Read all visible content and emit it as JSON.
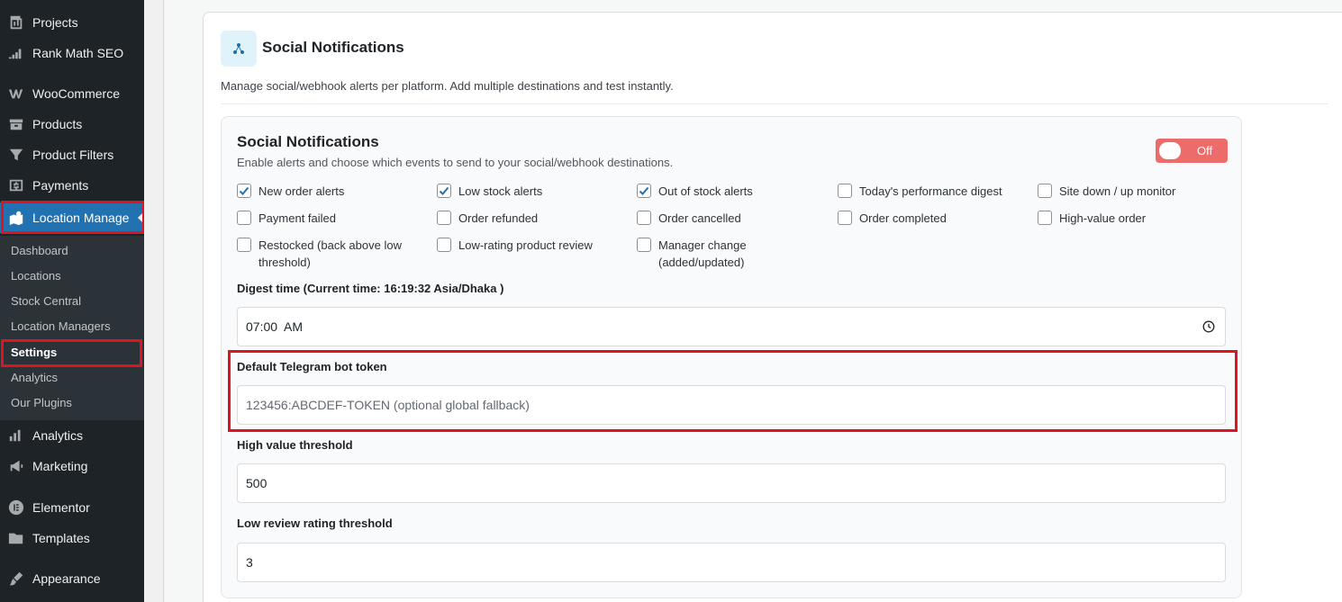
{
  "sidebar": {
    "items": [
      {
        "label": "Projects",
        "icon": "projects-icon"
      },
      {
        "label": "Rank Math SEO",
        "icon": "rank-math-icon"
      },
      {
        "label": "WooCommerce",
        "icon": "woocommerce-icon"
      },
      {
        "label": "Products",
        "icon": "products-icon"
      },
      {
        "label": "Product Filters",
        "icon": "filter-icon"
      },
      {
        "label": "Payments",
        "icon": "payments-icon"
      },
      {
        "label": "Location Manage",
        "icon": "location-icon"
      },
      {
        "label": "Analytics",
        "icon": "analytics-icon"
      },
      {
        "label": "Marketing",
        "icon": "megaphone-icon"
      },
      {
        "label": "Elementor",
        "icon": "elementor-icon"
      },
      {
        "label": "Templates",
        "icon": "folder-icon"
      },
      {
        "label": "Appearance",
        "icon": "brush-icon"
      }
    ],
    "submenu": [
      "Dashboard",
      "Locations",
      "Stock Central",
      "Location Managers",
      "Settings",
      "Analytics",
      "Our Plugins"
    ]
  },
  "panel": {
    "title": "Social Notifications",
    "description": "Manage social/webhook alerts per platform. Add multiple destinations and test instantly."
  },
  "card": {
    "title": "Social Notifications",
    "description": "Enable alerts and choose which events to send to your social/webhook destinations.",
    "toggle_label": "Off",
    "checkboxes": [
      {
        "label": "New order alerts",
        "checked": true
      },
      {
        "label": "Low stock alerts",
        "checked": true
      },
      {
        "label": "Out of stock alerts",
        "checked": true
      },
      {
        "label": "Today's performance digest",
        "checked": false
      },
      {
        "label": "Site down / up monitor",
        "checked": false
      },
      {
        "label": "Payment failed",
        "checked": false
      },
      {
        "label": "Order refunded",
        "checked": false
      },
      {
        "label": "Order cancelled",
        "checked": false
      },
      {
        "label": "Order completed",
        "checked": false
      },
      {
        "label": "High-value order",
        "checked": false
      },
      {
        "label": "Restocked (back above low threshold)",
        "checked": false
      },
      {
        "label": "Low-rating product review",
        "checked": false
      },
      {
        "label": "Manager change (added/updated)",
        "checked": false
      }
    ],
    "digest_label": "Digest time (Current time: 16:19:32 Asia/Dhaka )",
    "digest_value": "07:00  AM",
    "telegram_label": "Default Telegram bot token",
    "telegram_placeholder": "123456:ABCDEF-TOKEN (optional global fallback)",
    "high_value_label": "High value threshold",
    "high_value_value": "500",
    "low_review_label": "Low review rating threshold",
    "low_review_value": "3"
  },
  "colors": {
    "accent": "#2271b1",
    "highlight": "#e0141e",
    "toggle_off": "#ec6b6b"
  }
}
